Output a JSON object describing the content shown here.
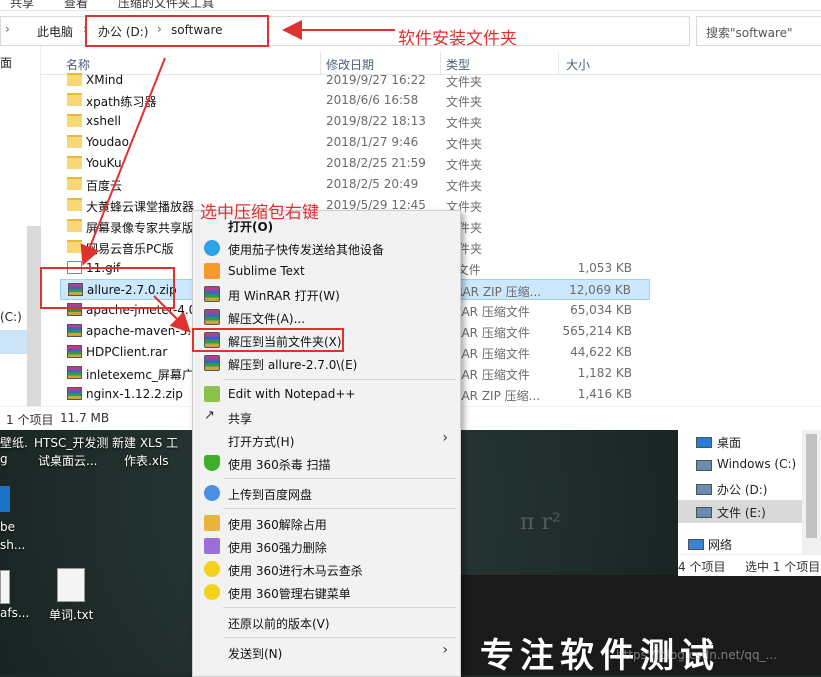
{
  "ribbon": {
    "tabs": [
      "共享",
      "查看",
      "压缩的文件夹工具"
    ]
  },
  "address": {
    "crumbs": [
      "此电脑",
      "办公 (D:)",
      "software"
    ]
  },
  "search": {
    "placeholder": "搜索\"software\""
  },
  "columns": {
    "name": "名称",
    "date": "修改日期",
    "type": "类型",
    "size": "大小"
  },
  "nav": {
    "face_label": "面",
    "drive_label": "(C:)"
  },
  "files": [
    {
      "name": "XMind",
      "date": "2019/9/27 16:22",
      "type": "文件夹",
      "size": "",
      "icon": "folder"
    },
    {
      "name": "xpath练习器",
      "date": "2018/6/6 16:58",
      "type": "文件夹",
      "size": "",
      "icon": "folder"
    },
    {
      "name": "xshell",
      "date": "2019/8/22 18:13",
      "type": "文件夹",
      "size": "",
      "icon": "folder"
    },
    {
      "name": "Youdao",
      "date": "2018/1/27 9:46",
      "type": "文件夹",
      "size": "",
      "icon": "folder"
    },
    {
      "name": "YouKu",
      "date": "2018/2/25 21:59",
      "type": "文件夹",
      "size": "",
      "icon": "folder"
    },
    {
      "name": "百度云",
      "date": "2018/2/5 20:49",
      "type": "文件夹",
      "size": "",
      "icon": "folder"
    },
    {
      "name": "大黄蜂云课堂播放器",
      "date": "2019/5/29 12:45",
      "type": "文件夹",
      "size": "",
      "icon": "folder"
    },
    {
      "name": "屏幕录像专家共享版",
      "date": "",
      "type": "文件夹",
      "size": "",
      "icon": "folder"
    },
    {
      "name": "网易云音乐PC版",
      "date": "",
      "type": "文件夹",
      "size": "",
      "icon": "folder"
    },
    {
      "name": "11.gif",
      "date": "",
      "type": "F 文件",
      "size": "1,053 KB",
      "icon": "gif"
    },
    {
      "name": "allure-2.7.0.zip",
      "date": "",
      "type": "nRAR ZIP 压缩...",
      "size": "12,069 KB",
      "icon": "zip"
    },
    {
      "name": "apache-jmeter-4.0",
      "date": "",
      "type": "nRAR 压缩文件",
      "size": "65,034 KB",
      "icon": "zip"
    },
    {
      "name": "apache-maven-3.5",
      "date": "",
      "type": "nRAR 压缩文件",
      "size": "565,214 KB",
      "icon": "zip"
    },
    {
      "name": "HDPClient.rar",
      "date": "",
      "type": "nRAR 压缩文件",
      "size": "44,622 KB",
      "icon": "zip"
    },
    {
      "name": "inletexemc_屏幕广",
      "date": "",
      "type": "nRAR 压缩文件",
      "size": "1,182 KB",
      "icon": "zip"
    },
    {
      "name": "nginx-1.12.2.zip",
      "date": "",
      "type": "nRAR ZIP 压缩...",
      "size": "1,416 KB",
      "icon": "zip"
    }
  ],
  "status": {
    "count": "1 个项目",
    "size": "11.7 MB"
  },
  "context_menu": {
    "items": [
      {
        "label": "打开(O)",
        "icon": "none",
        "bold": true,
        "sub": false
      },
      {
        "label": "使用茄子快传发送给其他设备",
        "icon": "qiezi-icon",
        "sub": false
      },
      {
        "label": "Sublime Text",
        "icon": "sublime-icon",
        "sub": false
      },
      {
        "label": "用 WinRAR 打开(W)",
        "icon": "winrar-icon",
        "sub": false
      },
      {
        "label": "解压文件(A)...",
        "icon": "winrar-icon",
        "sub": false
      },
      {
        "label": "解压到当前文件夹(X)",
        "icon": "winrar-icon",
        "sub": false
      },
      {
        "label": "解压到 allure-2.7.0\\(E)",
        "icon": "winrar-icon",
        "sub": false
      },
      {
        "label": "Edit with Notepad++",
        "icon": "notepad-icon",
        "sub": false
      },
      {
        "label": "共享",
        "icon": "share-icon",
        "sub": false
      },
      {
        "label": "打开方式(H)",
        "icon": "none",
        "sub": true
      },
      {
        "label": "使用 360杀毒 扫描",
        "icon": "shield-icon",
        "sub": false
      },
      {
        "label": "上传到百度网盘",
        "icon": "baidu-icon",
        "sub": false
      },
      {
        "label": "使用 360解除占用",
        "icon": "unlock-icon",
        "sub": false
      },
      {
        "label": "使用 360强力删除",
        "icon": "delete-icon",
        "sub": false
      },
      {
        "label": "使用 360进行木马云查杀",
        "icon": "360-icon",
        "sub": false
      },
      {
        "label": "使用 360管理右键菜单",
        "icon": "360-icon",
        "sub": false
      },
      {
        "label": "还原以前的版本(V)",
        "icon": "none",
        "sub": false
      },
      {
        "label": "发送到(N)",
        "icon": "none",
        "sub": true
      }
    ]
  },
  "desktop": {
    "icons": [
      {
        "label1": "壁纸.",
        "label2": "g"
      },
      {
        "label1": "HTSC_开发测",
        "label2": "试桌面云..."
      },
      {
        "label1": "新建 XLS 工",
        "label2": "作表.xls"
      },
      {
        "label1": "be",
        "label2": "sh..."
      },
      {
        "label1": "afs...",
        "label2": ""
      },
      {
        "label1": "单词.txt",
        "label2": ""
      }
    ],
    "banner": "专注软件测试",
    "watermark": "https://blog.csdn.net/qq_..."
  },
  "side_pane": {
    "items": [
      "桌面",
      "Windows (C:)",
      "办公 (D:)",
      "文件 (E:)",
      "网络"
    ],
    "status_left": "4 个项目",
    "status_right": "选中 1 个项目"
  },
  "annotations": {
    "folder_label": "软件安装文件夹",
    "rightclick_label": "选中压缩包右键"
  },
  "colors": {
    "annotation": "#e03131",
    "selection": "#cce8ff",
    "menu_bg": "#f2f2f2"
  }
}
